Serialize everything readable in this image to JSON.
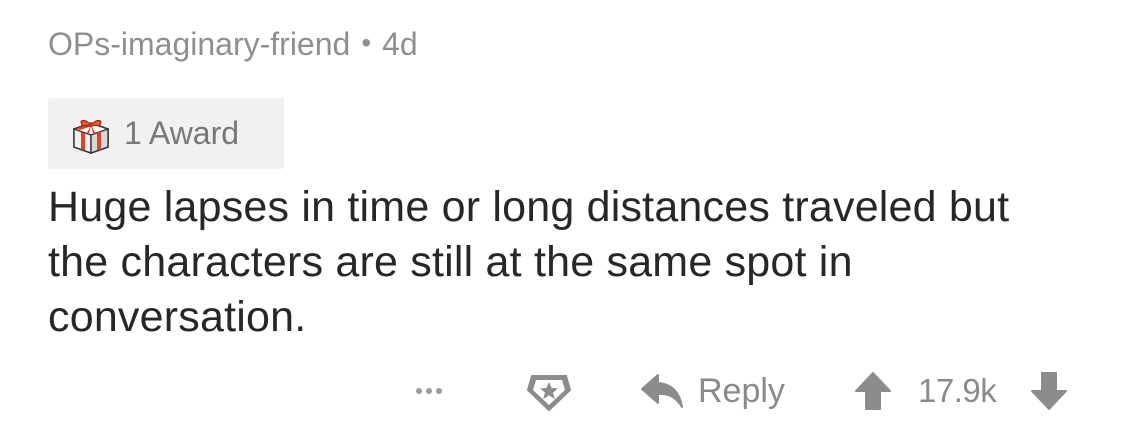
{
  "comment": {
    "author": "OPs-imaginary-friend",
    "separator": "•",
    "age": "4d",
    "award": {
      "icon": "gift-icon",
      "label": "1 Award"
    },
    "body": "Huge lapses in time or long distances traveled but the characters are still at the same spot in conversation."
  },
  "actions": {
    "more_icon": "ellipsis-icon",
    "give_award_icon": "award-icon",
    "reply_icon": "reply-arrow-icon",
    "reply_label": "Reply",
    "upvote_icon": "upvote-arrow-icon",
    "score": "17.9k",
    "downvote_icon": "downvote-arrow-icon"
  },
  "colors": {
    "meta_text": "#8f8f8f",
    "body_text": "#272727",
    "chip_background": "#f1f1f1",
    "action_icon": "#8c8c8c"
  }
}
